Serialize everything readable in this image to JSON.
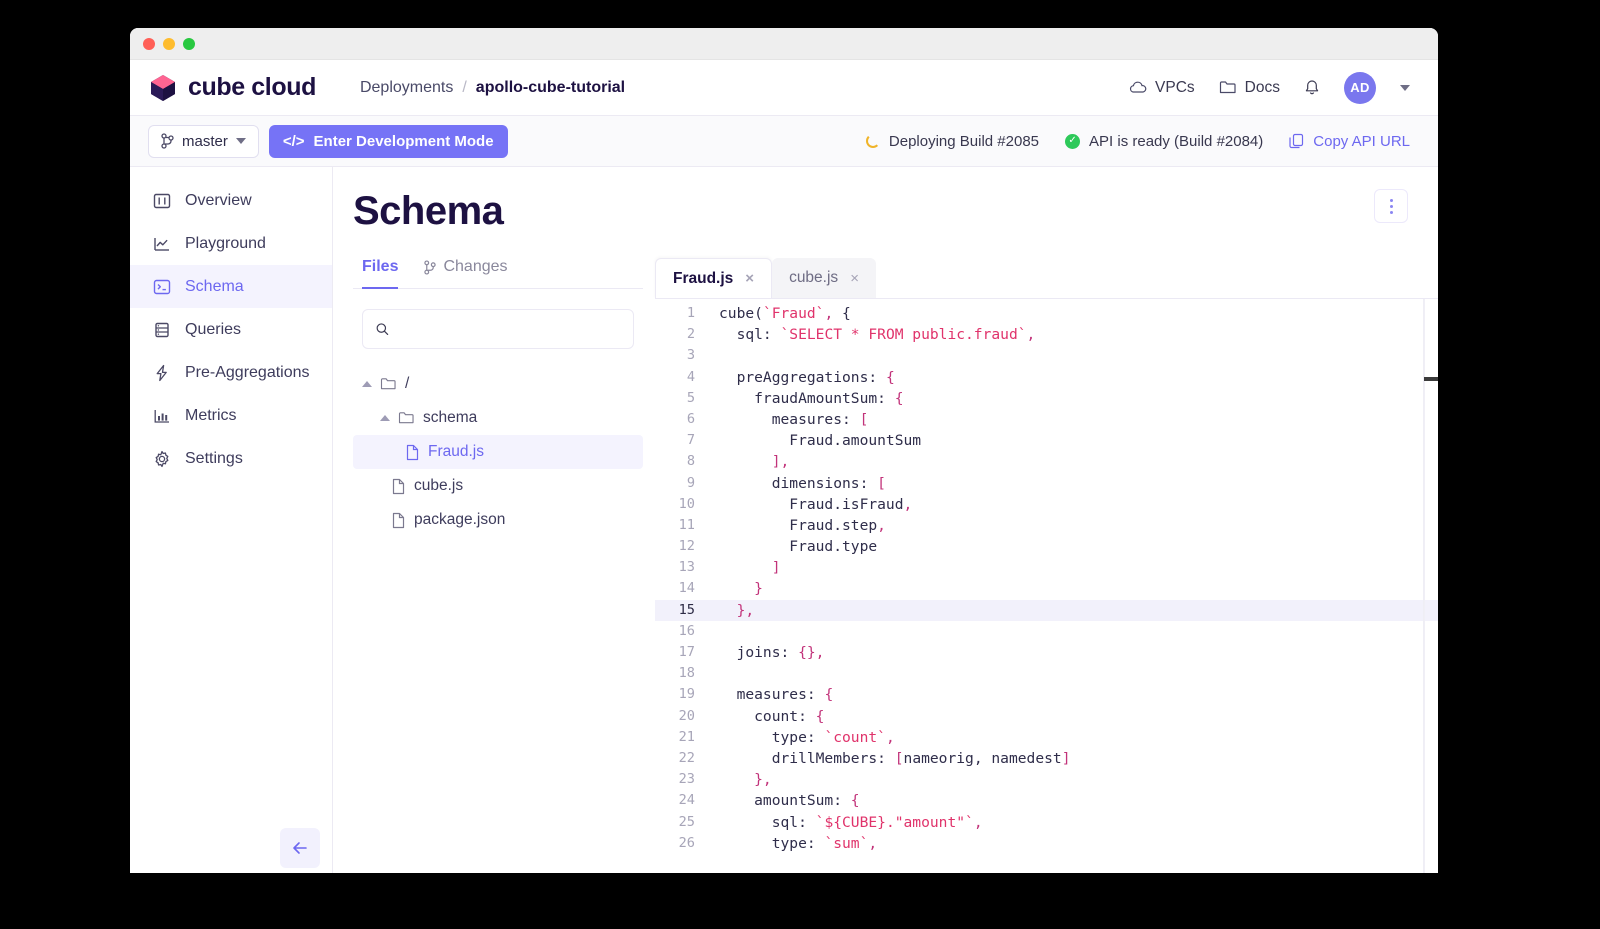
{
  "window": {
    "traffic_lights": [
      "close",
      "minimize",
      "zoom"
    ]
  },
  "header": {
    "brand": "cube cloud",
    "breadcrumb": {
      "parent": "Deployments",
      "separator": "/",
      "current": "apollo-cube-tutorial"
    },
    "vpcs_label": "VPCs",
    "docs_label": "Docs",
    "avatar_initials": "AD"
  },
  "subheader": {
    "branch": "master",
    "dev_mode_button": "Enter Development Mode",
    "dev_mode_icon_text": "</>",
    "deploying_status": "Deploying Build #2085",
    "api_status": "API is ready (Build #2084)",
    "copy_api_url": "Copy API URL"
  },
  "sidebar": {
    "items": [
      {
        "label": "Overview",
        "icon": "overview-icon",
        "active": false
      },
      {
        "label": "Playground",
        "icon": "chart-line-icon",
        "active": false
      },
      {
        "label": "Schema",
        "icon": "terminal-icon",
        "active": true
      },
      {
        "label": "Queries",
        "icon": "database-icon",
        "active": false
      },
      {
        "label": "Pre-Aggregations",
        "icon": "lightning-icon",
        "active": false
      },
      {
        "label": "Metrics",
        "icon": "bar-chart-icon",
        "active": false
      },
      {
        "label": "Settings",
        "icon": "gear-icon",
        "active": false
      }
    ],
    "collapse_icon": "arrow-left-icon"
  },
  "main": {
    "page_title": "Schema",
    "kebab_menu": "more-options"
  },
  "files_pane": {
    "tabs": [
      {
        "label": "Files",
        "active": true
      },
      {
        "label": "Changes",
        "active": false,
        "icon": "branch-icon"
      }
    ],
    "search_placeholder": "",
    "search_value": "",
    "tree": [
      {
        "label": "/",
        "type": "folder",
        "depth": 0,
        "expanded": true,
        "selected": false
      },
      {
        "label": "schema",
        "type": "folder",
        "depth": 1,
        "expanded": true,
        "selected": false
      },
      {
        "label": "Fraud.js",
        "type": "file",
        "depth": 2,
        "selected": true
      },
      {
        "label": "cube.js",
        "type": "file",
        "depth": 1,
        "selected": false
      },
      {
        "label": "package.json",
        "type": "file",
        "depth": 1,
        "selected": false
      }
    ]
  },
  "editor": {
    "tabs": [
      {
        "label": "Fraud.js",
        "active": true,
        "close": "×"
      },
      {
        "label": "cube.js",
        "active": false,
        "close": "×"
      }
    ],
    "active_line": 15,
    "lines": [
      {
        "n": 1,
        "tokens": [
          {
            "t": "cube(",
            "c": "plain"
          },
          {
            "t": "`Fraud`",
            "c": "str"
          },
          {
            "t": ",",
            "c": "punc"
          },
          {
            "t": " {",
            "c": "plain"
          }
        ]
      },
      {
        "n": 2,
        "tokens": [
          {
            "t": "  sql: ",
            "c": "plain"
          },
          {
            "t": "`SELECT * FROM public.fraud`",
            "c": "str"
          },
          {
            "t": ",",
            "c": "punc"
          }
        ]
      },
      {
        "n": 3,
        "tokens": [
          {
            "t": "",
            "c": "plain"
          }
        ]
      },
      {
        "n": 4,
        "tokens": [
          {
            "t": "  preAggregations: ",
            "c": "plain"
          },
          {
            "t": "{",
            "c": "punc"
          }
        ]
      },
      {
        "n": 5,
        "tokens": [
          {
            "t": "    fraudAmountSum: ",
            "c": "plain"
          },
          {
            "t": "{",
            "c": "punc"
          }
        ]
      },
      {
        "n": 6,
        "tokens": [
          {
            "t": "      measures: ",
            "c": "plain"
          },
          {
            "t": "[",
            "c": "punc"
          }
        ]
      },
      {
        "n": 7,
        "tokens": [
          {
            "t": "        Fraud.amountSum",
            "c": "plain"
          }
        ]
      },
      {
        "n": 8,
        "tokens": [
          {
            "t": "      ],",
            "c": "punc"
          }
        ]
      },
      {
        "n": 9,
        "tokens": [
          {
            "t": "      dimensions: ",
            "c": "plain"
          },
          {
            "t": "[",
            "c": "punc"
          }
        ]
      },
      {
        "n": 10,
        "tokens": [
          {
            "t": "        Fraud.isFraud",
            "c": "plain"
          },
          {
            "t": ",",
            "c": "punc"
          }
        ]
      },
      {
        "n": 11,
        "tokens": [
          {
            "t": "        Fraud.step",
            "c": "plain"
          },
          {
            "t": ",",
            "c": "punc"
          }
        ]
      },
      {
        "n": 12,
        "tokens": [
          {
            "t": "        Fraud.type",
            "c": "plain"
          }
        ]
      },
      {
        "n": 13,
        "tokens": [
          {
            "t": "      ]",
            "c": "punc"
          }
        ]
      },
      {
        "n": 14,
        "tokens": [
          {
            "t": "    }",
            "c": "punc"
          }
        ]
      },
      {
        "n": 15,
        "tokens": [
          {
            "t": "  },",
            "c": "punc"
          }
        ]
      },
      {
        "n": 16,
        "tokens": [
          {
            "t": "",
            "c": "plain"
          }
        ]
      },
      {
        "n": 17,
        "tokens": [
          {
            "t": "  joins: ",
            "c": "plain"
          },
          {
            "t": "{},",
            "c": "punc"
          }
        ]
      },
      {
        "n": 18,
        "tokens": [
          {
            "t": "",
            "c": "plain"
          }
        ]
      },
      {
        "n": 19,
        "tokens": [
          {
            "t": "  measures: ",
            "c": "plain"
          },
          {
            "t": "{",
            "c": "punc"
          }
        ]
      },
      {
        "n": 20,
        "tokens": [
          {
            "t": "    count: ",
            "c": "plain"
          },
          {
            "t": "{",
            "c": "punc"
          }
        ]
      },
      {
        "n": 21,
        "tokens": [
          {
            "t": "      type: ",
            "c": "plain"
          },
          {
            "t": "`count`",
            "c": "str"
          },
          {
            "t": ",",
            "c": "punc"
          }
        ]
      },
      {
        "n": 22,
        "tokens": [
          {
            "t": "      drillMembers: ",
            "c": "plain"
          },
          {
            "t": "[",
            "c": "punc"
          },
          {
            "t": "nameorig, namedest",
            "c": "plain"
          },
          {
            "t": "]",
            "c": "punc"
          }
        ]
      },
      {
        "n": 23,
        "tokens": [
          {
            "t": "    },",
            "c": "punc"
          }
        ]
      },
      {
        "n": 24,
        "tokens": [
          {
            "t": "    amountSum: ",
            "c": "plain"
          },
          {
            "t": "{",
            "c": "punc"
          }
        ]
      },
      {
        "n": 25,
        "tokens": [
          {
            "t": "      sql: ",
            "c": "plain"
          },
          {
            "t": "`${CUBE}.\"amount\"`",
            "c": "str"
          },
          {
            "t": ",",
            "c": "punc"
          }
        ]
      },
      {
        "n": 26,
        "tokens": [
          {
            "t": "      type: ",
            "c": "plain"
          },
          {
            "t": "`sum`",
            "c": "str"
          },
          {
            "t": ",",
            "c": "punc"
          }
        ]
      }
    ]
  },
  "colors": {
    "accent": "#6d68f0",
    "accent_button": "#7673f6",
    "title": "#1d1142",
    "status_ok": "#2ec95a",
    "status_pending": "#f0b429",
    "string_token": "#e0336b",
    "punct_token": "#c2337a"
  }
}
